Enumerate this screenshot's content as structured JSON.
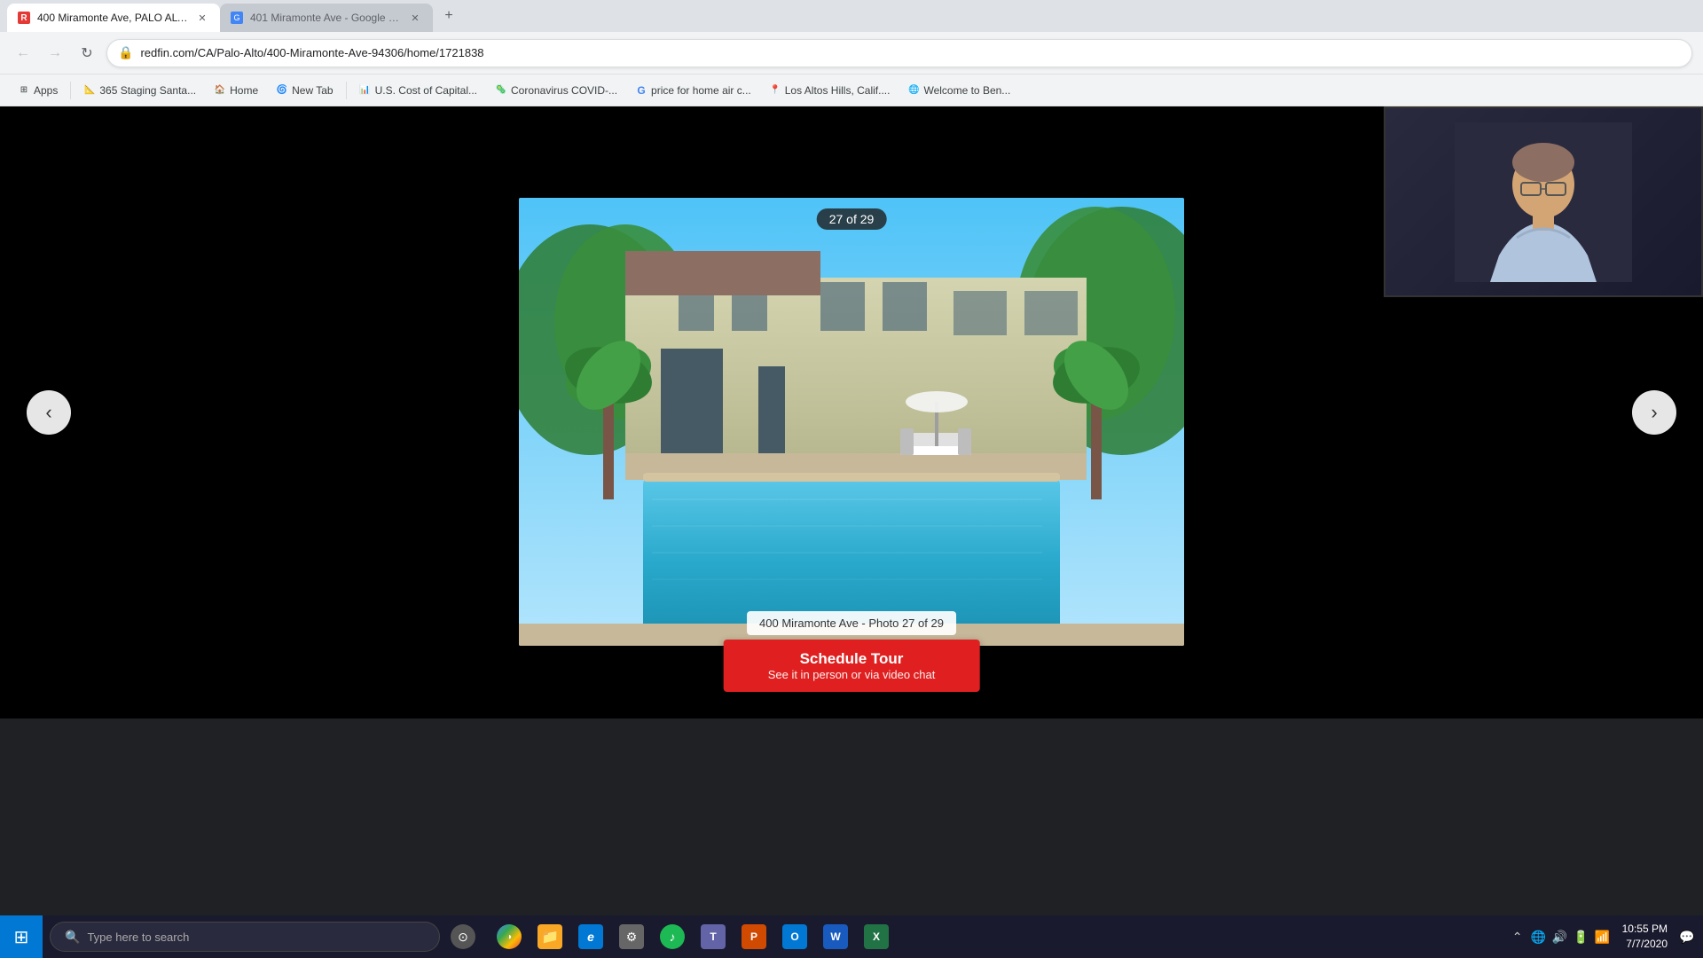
{
  "browser": {
    "tabs": [
      {
        "id": "tab1",
        "favicon_color": "#e53935",
        "favicon_letter": "R",
        "title": "400 Miramonte Ave, PALO ALTO...",
        "active": true,
        "url": "redfin.com/CA/Palo-Alto/400-Miramonte-Ave-94306/home/1721838"
      },
      {
        "id": "tab2",
        "favicon_color": "#4285f4",
        "favicon_letter": "G",
        "title": "401 Miramonte Ave - Google M...",
        "active": false
      }
    ],
    "address": "redfin.com/CA/Palo-Alto/400-Miramonte-Ave-94306/home/1721838",
    "bookmarks": [
      {
        "id": "bm1",
        "label": "Apps",
        "favicon": "⊞",
        "color": "#4285f4"
      },
      {
        "id": "bm2",
        "label": "365 Staging Santa...",
        "favicon": "📐",
        "color": "#888"
      },
      {
        "id": "bm3",
        "label": "Home",
        "favicon": "🏠",
        "color": "#888"
      },
      {
        "id": "bm4",
        "label": "New Tab",
        "favicon": "🌀",
        "color": "#4285f4"
      },
      {
        "id": "bm5",
        "label": "U.S. Cost of Capital...",
        "favicon": "📊",
        "color": "#e53935"
      },
      {
        "id": "bm6",
        "label": "Coronavirus COVID-...",
        "favicon": "🦠",
        "color": "#2196f3"
      },
      {
        "id": "bm7",
        "label": "price for home air c...",
        "favicon": "G",
        "color": "#4285f4"
      },
      {
        "id": "bm8",
        "label": "Los Altos Hills, Calif....",
        "favicon": "📍",
        "color": "#e53935"
      },
      {
        "id": "bm9",
        "label": "Welcome to Ben...",
        "favicon": "🌐",
        "color": "#4285f4"
      }
    ]
  },
  "photo_viewer": {
    "counter": "27 of 29",
    "caption": "400 Miramonte Ave - Photo 27 of 29",
    "nav_left": "‹",
    "nav_right": "›"
  },
  "schedule_tour": {
    "title": "Schedule Tour",
    "subtitle": "See it in person or via video chat"
  },
  "taskbar": {
    "search_placeholder": "Type here to search",
    "clock_time": "10:55 PM",
    "clock_date": "7/7/2020",
    "apps": [
      {
        "id": "cortana",
        "icon": "⊙",
        "label": "Cortana",
        "color": "#555"
      },
      {
        "id": "chrome",
        "icon": "◑",
        "label": "Chrome",
        "color": "#4285f4"
      },
      {
        "id": "files",
        "icon": "📁",
        "label": "File Explorer",
        "color": "#f9a825"
      },
      {
        "id": "edge",
        "icon": "e",
        "label": "Edge",
        "color": "#0078d4"
      },
      {
        "id": "settings",
        "icon": "⚙",
        "label": "Settings",
        "color": "#888"
      },
      {
        "id": "spotify",
        "icon": "♪",
        "label": "Spotify",
        "color": "#1db954"
      },
      {
        "id": "teams",
        "icon": "T",
        "label": "Teams",
        "color": "#6264a7"
      },
      {
        "id": "powerpoint",
        "icon": "P",
        "label": "PowerPoint",
        "color": "#d04a02"
      },
      {
        "id": "outlook",
        "icon": "O",
        "label": "Outlook",
        "color": "#0078d4"
      },
      {
        "id": "word",
        "icon": "W",
        "label": "Word",
        "color": "#185abd"
      },
      {
        "id": "excel",
        "icon": "X",
        "label": "Excel",
        "color": "#217346"
      }
    ]
  }
}
